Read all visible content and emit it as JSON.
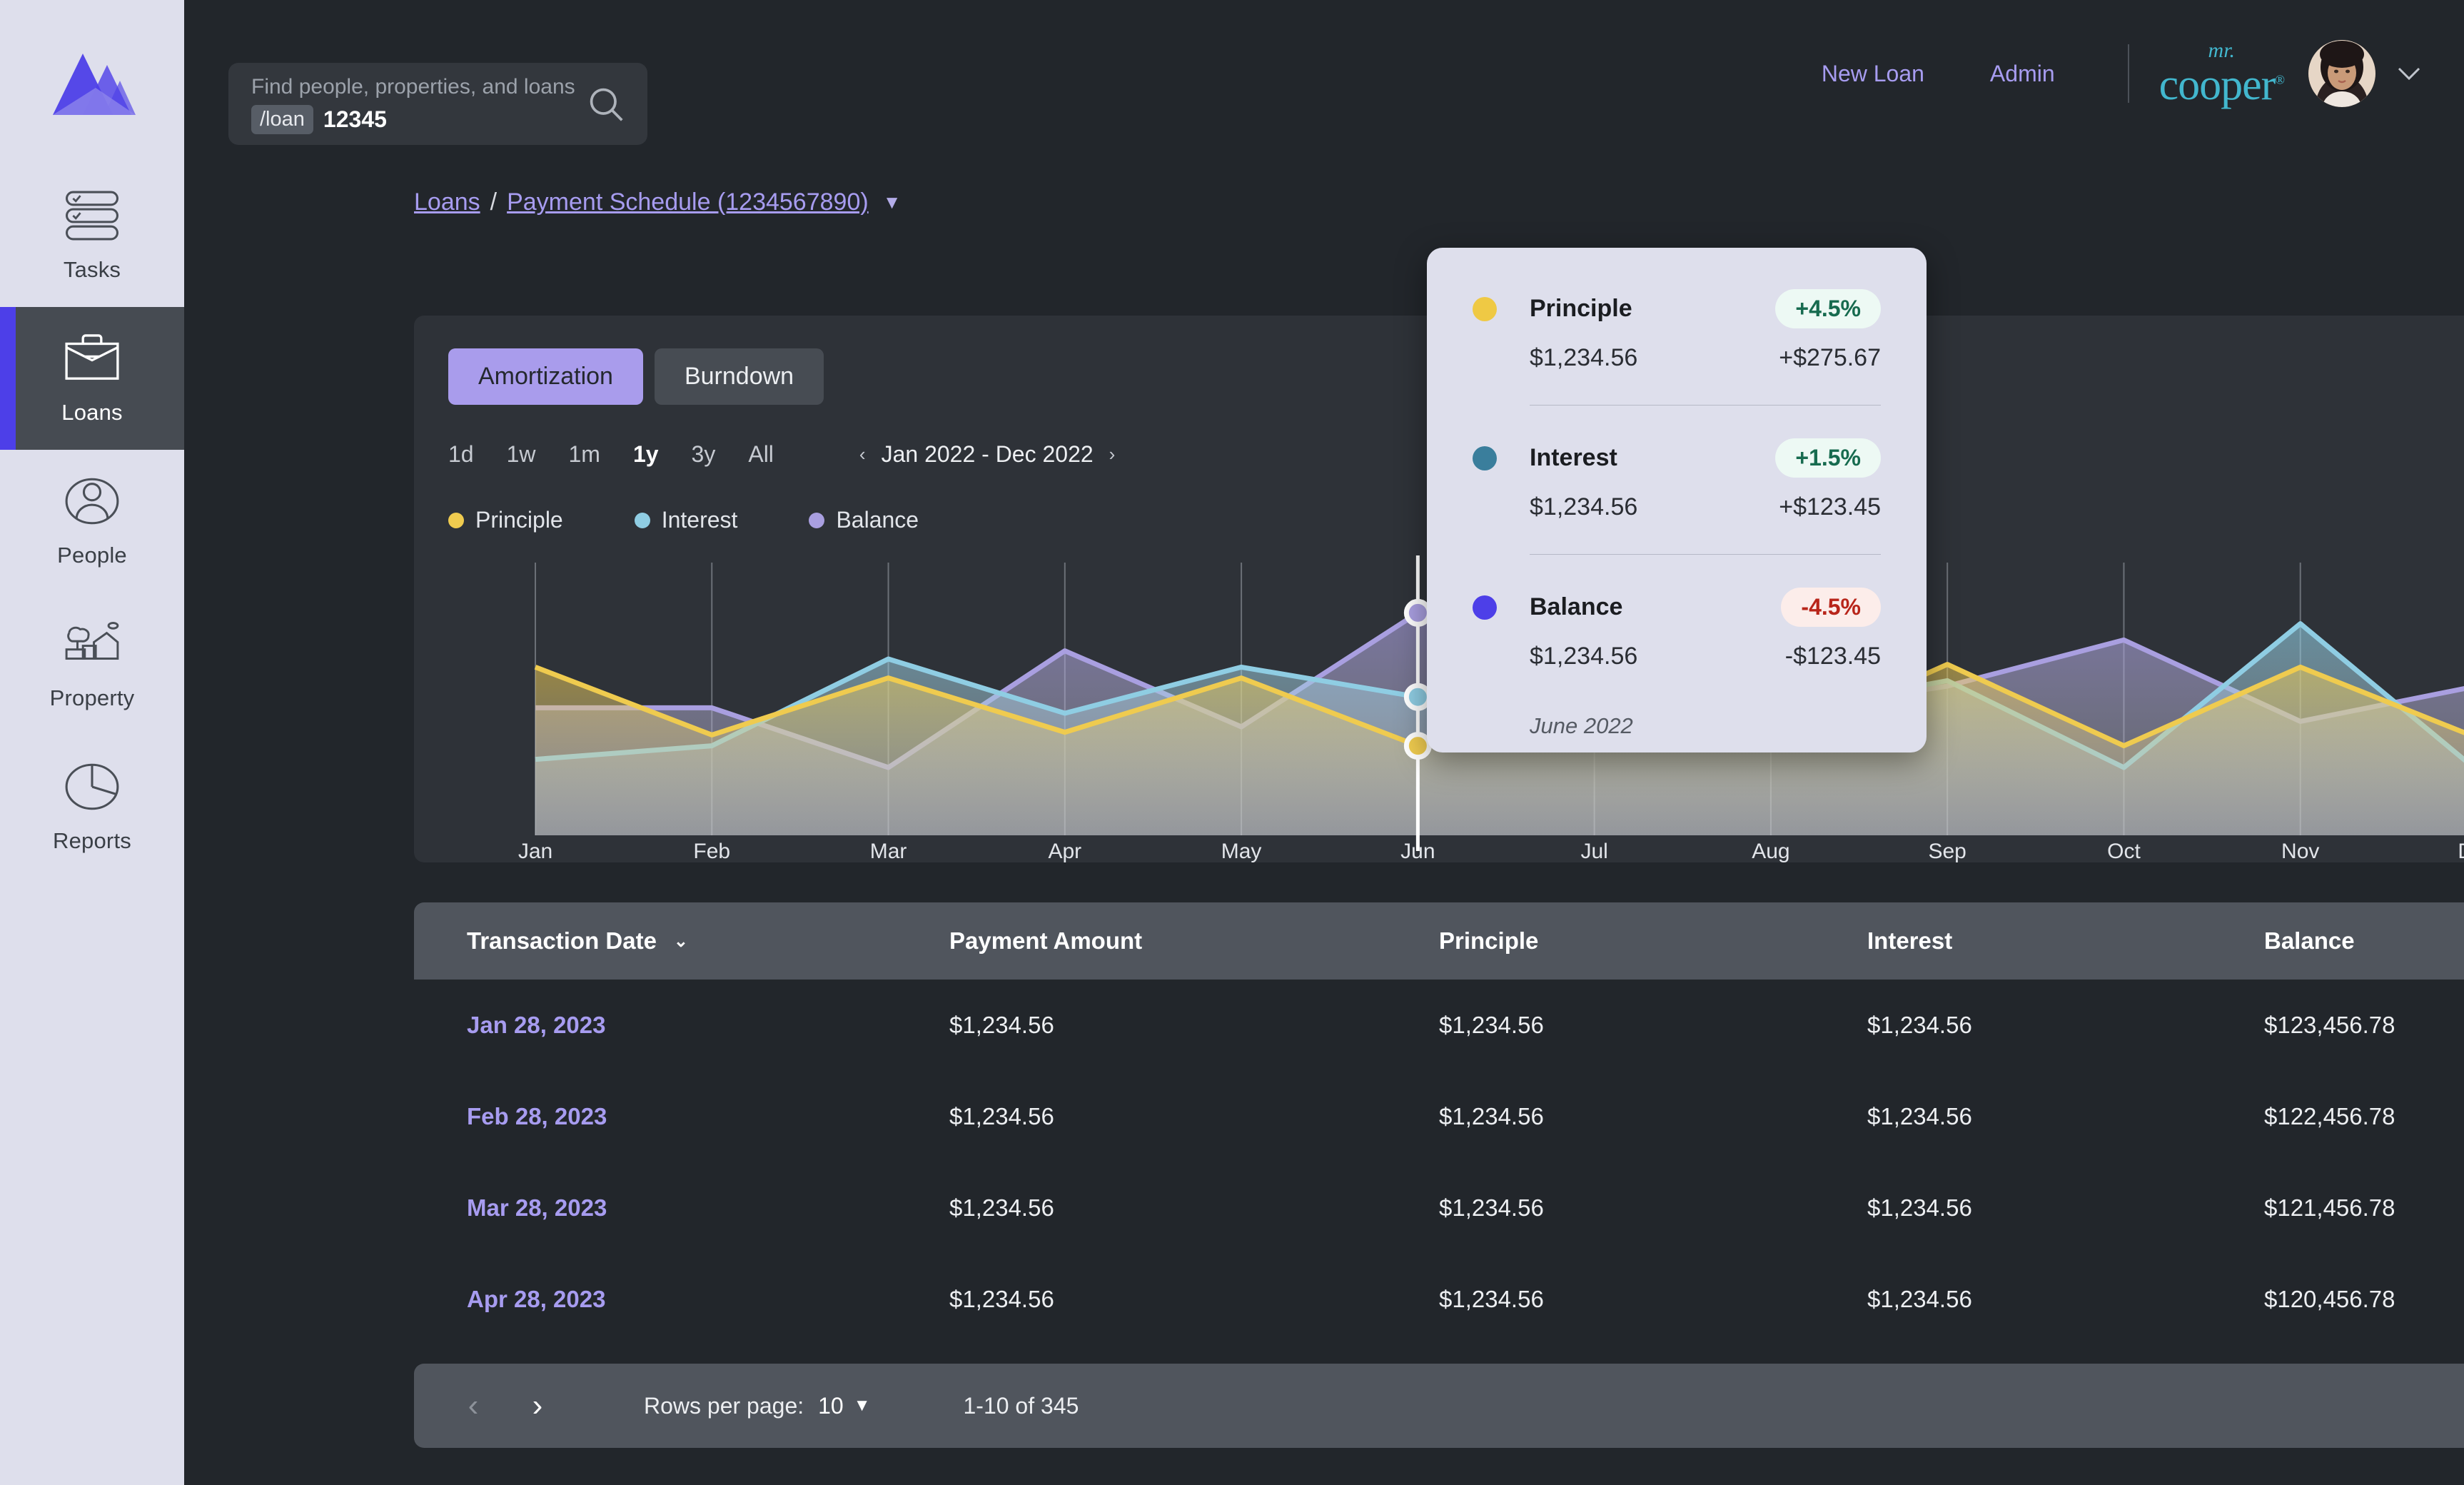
{
  "sidebar": {
    "logo": "mountains-logo",
    "items": [
      {
        "label": "Tasks",
        "icon": "tasks-icon",
        "active": false
      },
      {
        "label": "Loans",
        "icon": "briefcase-icon",
        "active": true
      },
      {
        "label": "People",
        "icon": "people-icon",
        "active": false
      },
      {
        "label": "Property",
        "icon": "property-icon",
        "active": false
      },
      {
        "label": "Reports",
        "icon": "pie-chart-icon",
        "active": false
      }
    ]
  },
  "header": {
    "search": {
      "placeholder": "Find people, properties, and loans",
      "chip": "/loan",
      "value": "12345",
      "icon": "search-icon"
    },
    "links": [
      {
        "label": "New Loan"
      },
      {
        "label": "Admin"
      }
    ],
    "brand": {
      "line1": "mr.",
      "line2": "cooper",
      "mark": "®"
    },
    "avatar": "user-avatar",
    "caret": "chevron-down-icon"
  },
  "breadcrumb": {
    "root": "Loans",
    "separator": "/",
    "current": "Payment Schedule (1234567890)",
    "caret": "▼"
  },
  "chart_card": {
    "tabs": [
      {
        "label": "Amortization",
        "active": true
      },
      {
        "label": "Burndown",
        "active": false
      }
    ],
    "ranges": [
      {
        "label": "1d",
        "active": false
      },
      {
        "label": "1w",
        "active": false
      },
      {
        "label": "1m",
        "active": false
      },
      {
        "label": "1y",
        "active": true
      },
      {
        "label": "3y",
        "active": false
      },
      {
        "label": "All",
        "active": false
      }
    ],
    "date_range": {
      "prev": "‹",
      "text": "Jan 2022 - Dec 2022",
      "next": "›"
    }
  },
  "chart_data": {
    "type": "area",
    "title": "",
    "xlabel": "",
    "ylabel": "",
    "grid": true,
    "legend_position": "top-left",
    "categories": [
      "Jan",
      "Feb",
      "Mar",
      "Apr",
      "May",
      "Jun",
      "Jul",
      "Aug",
      "Sep",
      "Oct",
      "Nov",
      "Dec"
    ],
    "colors": {
      "principle": "#EFCB4F",
      "interest": "#8FCDE3",
      "balance": "#A99FE0"
    },
    "ylim": [
      0,
      100
    ],
    "series": [
      {
        "name": "Principle",
        "color": "#EFCB4F",
        "values": [
          62,
          37,
          58,
          38,
          58,
          33,
          46,
          34,
          63,
          33,
          62,
          36
        ]
      },
      {
        "name": "Interest",
        "color": "#8FCDE3",
        "values": [
          28,
          33,
          65,
          45,
          62,
          51,
          40,
          45,
          57,
          25,
          78,
          24
        ]
      },
      {
        "name": "Balance",
        "color": "#A99FE0",
        "values": [
          47,
          47,
          25,
          68,
          40,
          82,
          32,
          45,
          55,
          72,
          42,
          55
        ]
      }
    ],
    "hover": {
      "x": "Jun",
      "markers": [
        "Balance",
        "Interest",
        "Principle"
      ]
    }
  },
  "tooltip": {
    "rows": [
      {
        "name": "Principle",
        "color": "#EFC944",
        "pct": "+4.5%",
        "pct_sign": "pos",
        "value": "$1,234.56",
        "delta": "+$275.67"
      },
      {
        "name": "Interest",
        "color": "#3A7E9C",
        "pct": "+1.5%",
        "pct_sign": "pos",
        "value": "$1,234.56",
        "delta": "+$123.45"
      },
      {
        "name": "Balance",
        "color": "#4D3FE8",
        "pct": "-4.5%",
        "pct_sign": "neg",
        "value": "$1,234.56",
        "delta": "-$123.45"
      }
    ],
    "date": "June 2022"
  },
  "table": {
    "columns": [
      "Transaction Date",
      "Payment Amount",
      "Principle",
      "Interest",
      "Balance"
    ],
    "sort_caret": "⌄",
    "rows": [
      {
        "date": "Jan 28, 2023",
        "payment": "$1,234.56",
        "principle": "$1,234.56",
        "interest": "$1,234.56",
        "balance": "$123,456.78"
      },
      {
        "date": "Feb 28, 2023",
        "payment": "$1,234.56",
        "principle": "$1,234.56",
        "interest": "$1,234.56",
        "balance": "$122,456.78"
      },
      {
        "date": "Mar 28, 2023",
        "payment": "$1,234.56",
        "principle": "$1,234.56",
        "interest": "$1,234.56",
        "balance": "$121,456.78"
      },
      {
        "date": "Apr 28, 2023",
        "payment": "$1,234.56",
        "principle": "$1,234.56",
        "interest": "$1,234.56",
        "balance": "$120,456.78"
      }
    ]
  },
  "footer": {
    "prev": "‹",
    "next": "›",
    "rows_per_page_label": "Rows per page:",
    "rows_per_page_value": "10",
    "caret": "▼",
    "range_count": "1-10 of 345"
  }
}
